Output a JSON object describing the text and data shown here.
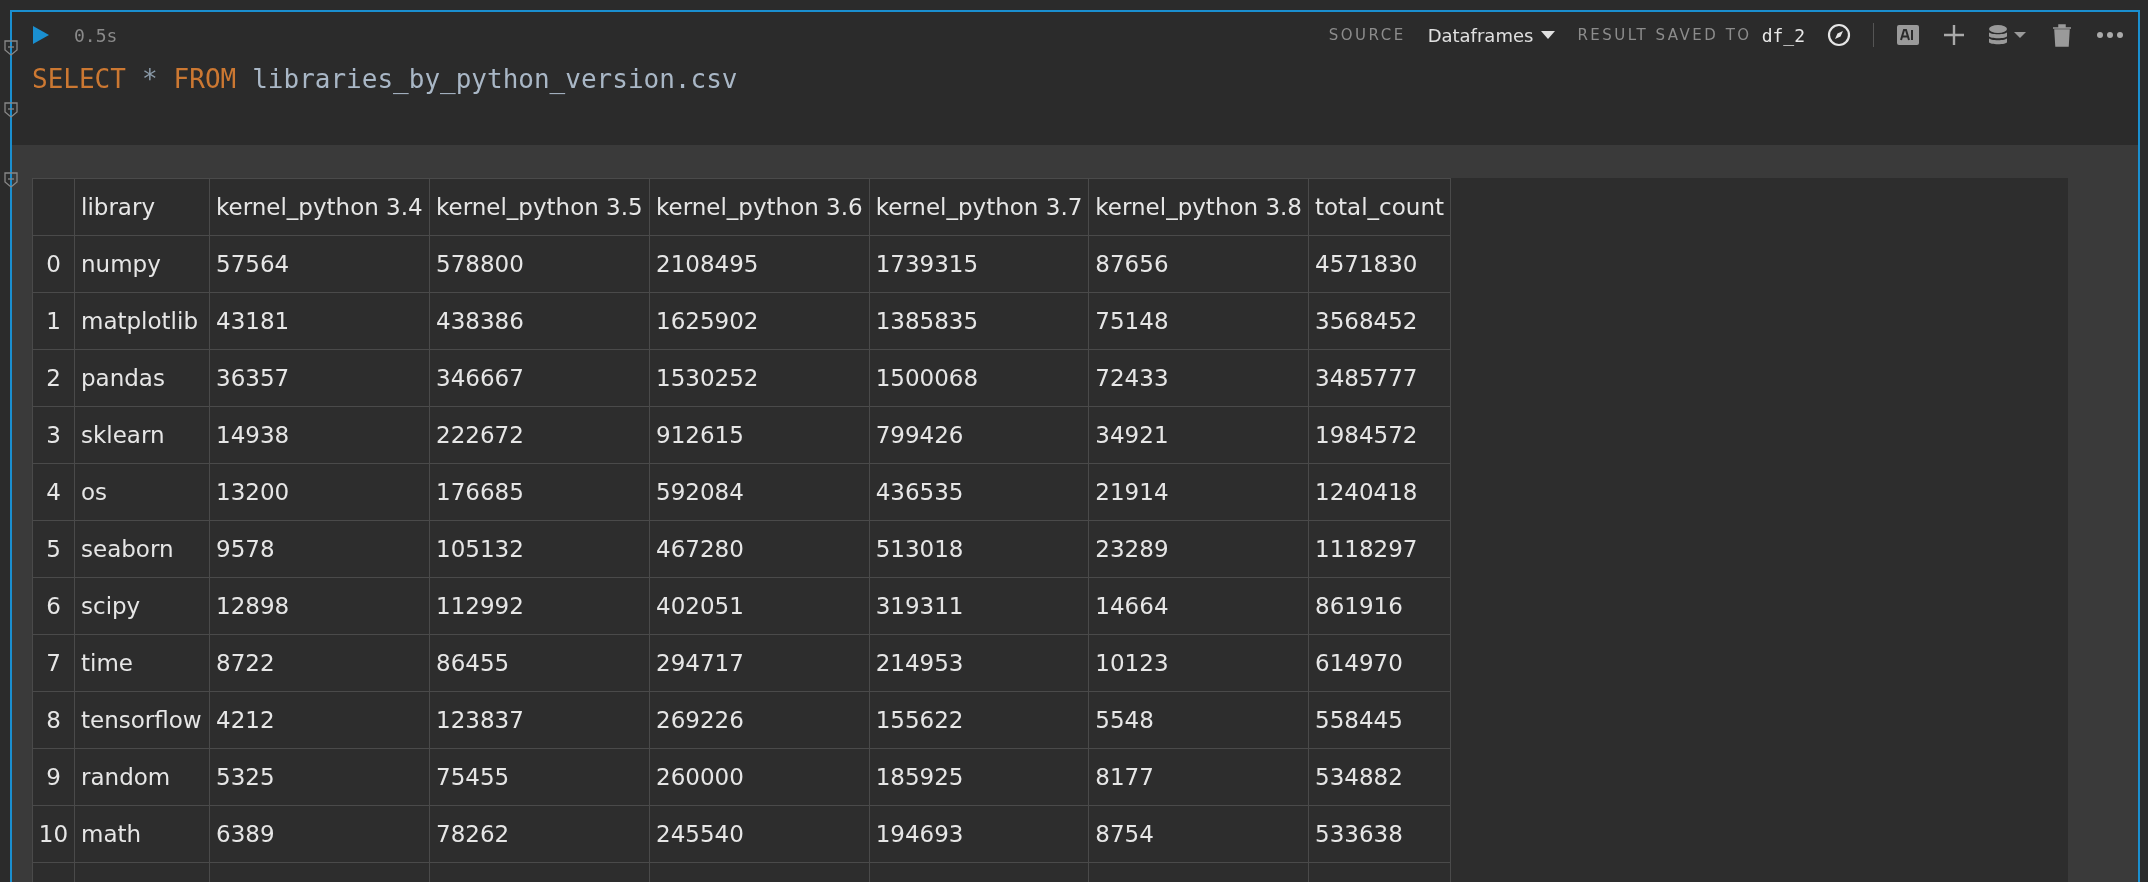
{
  "cell": {
    "run_time": "0.5s",
    "toolbar": {
      "source_label": "SOURCE",
      "source_value": "Dataframes",
      "result_label": "RESULT SAVED TO",
      "result_value": "df_2"
    },
    "query": [
      {
        "kind": "keyword",
        "text": "SELECT"
      },
      {
        "kind": "operator",
        "text": "*"
      },
      {
        "kind": "keyword",
        "text": "FROM"
      },
      {
        "kind": "identifier",
        "text": "libraries_by_python_version.csv"
      }
    ]
  },
  "table": {
    "columns": [
      "library",
      "kernel_python 3.4",
      "kernel_python 3.5",
      "kernel_python 3.6",
      "kernel_python 3.7",
      "kernel_python 3.8",
      "total_count"
    ],
    "rows": [
      {
        "index": "0",
        "cells": [
          "numpy",
          "57564",
          "578800",
          "2108495",
          "1739315",
          "87656",
          "4571830"
        ]
      },
      {
        "index": "1",
        "cells": [
          "matplotlib",
          "43181",
          "438386",
          "1625902",
          "1385835",
          "75148",
          "3568452"
        ]
      },
      {
        "index": "2",
        "cells": [
          "pandas",
          "36357",
          "346667",
          "1530252",
          "1500068",
          "72433",
          "3485777"
        ]
      },
      {
        "index": "3",
        "cells": [
          "sklearn",
          "14938",
          "222672",
          "912615",
          "799426",
          "34921",
          "1984572"
        ]
      },
      {
        "index": "4",
        "cells": [
          "os",
          "13200",
          "176685",
          "592084",
          "436535",
          "21914",
          "1240418"
        ]
      },
      {
        "index": "5",
        "cells": [
          "seaborn",
          "9578",
          "105132",
          "467280",
          "513018",
          "23289",
          "1118297"
        ]
      },
      {
        "index": "6",
        "cells": [
          "scipy",
          "12898",
          "112992",
          "402051",
          "319311",
          "14664",
          "861916"
        ]
      },
      {
        "index": "7",
        "cells": [
          "time",
          "8722",
          "86455",
          "294717",
          "214953",
          "10123",
          "614970"
        ]
      },
      {
        "index": "8",
        "cells": [
          "tensorflow",
          "4212",
          "123837",
          "269226",
          "155622",
          "5548",
          "558445"
        ]
      },
      {
        "index": "9",
        "cells": [
          "random",
          "5325",
          "75455",
          "260000",
          "185925",
          "8177",
          "534882"
        ]
      },
      {
        "index": "10",
        "cells": [
          "math",
          "6389",
          "78262",
          "245540",
          "194693",
          "8754",
          "533638"
        ]
      }
    ]
  }
}
